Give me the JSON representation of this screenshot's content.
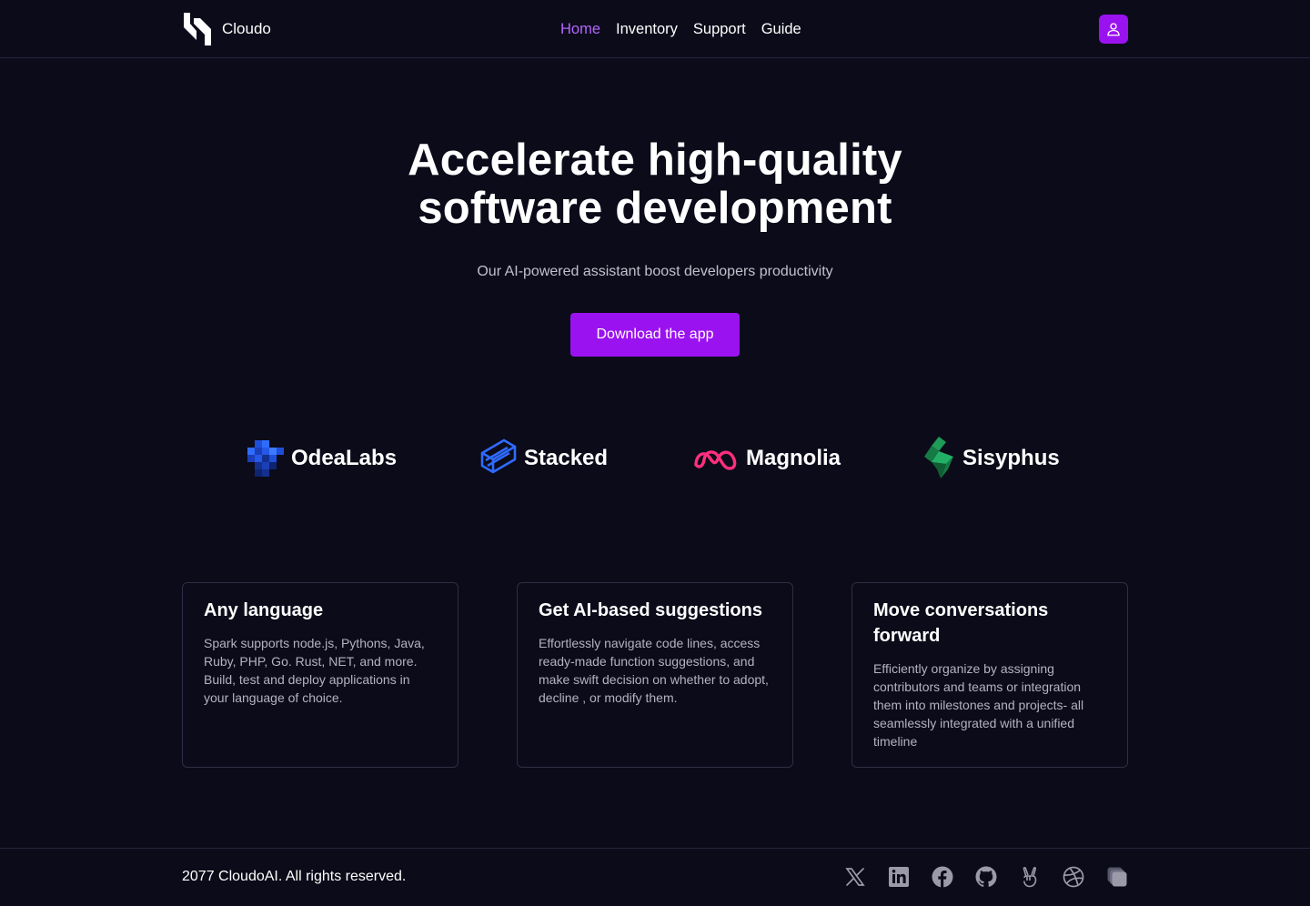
{
  "header": {
    "brand": "Cloudo",
    "nav": [
      {
        "label": "Home",
        "active": true
      },
      {
        "label": "Inventory",
        "active": false
      },
      {
        "label": "Support",
        "active": false
      },
      {
        "label": "Guide",
        "active": false
      }
    ],
    "user_icon": "user-icon"
  },
  "hero": {
    "title_line1": "Accelerate high-quality",
    "title_line2": "software development",
    "subtitle": "Our AI-powered assistant boost developers productivity",
    "cta_label": "Download the app"
  },
  "brands": [
    {
      "name": "OdeaLabs",
      "icon": "odealabs-logo"
    },
    {
      "name": "Stacked",
      "icon": "stacked-logo"
    },
    {
      "name": "Magnolia",
      "icon": "magnolia-logo"
    },
    {
      "name": "Sisyphus",
      "icon": "sisyphus-logo"
    }
  ],
  "features": [
    {
      "title": "Any language",
      "body": "Spark supports node.js, Pythons, Java, Ruby, PHP, Go. Rust, NET, and more. Build, test and deploy applications in your language of choice."
    },
    {
      "title": "Get AI-based suggestions",
      "body": "Effortlessly navigate code lines, access ready-made function suggestions, and make swift decision on whether to adopt, decline , or modify them."
    },
    {
      "title": "Move conversations forward",
      "body": "Efficiently organize by assigning contributors and teams  or integration them into milestones and projects- all seamlessly integrated with a unified timeline"
    }
  ],
  "footer": {
    "copyright": "2077 CloudoAI. All rights reserved.",
    "socials": [
      "x-icon",
      "linkedin-icon",
      "facebook-icon",
      "github-icon",
      "angellist-icon",
      "dribbble-icon",
      "buffer-icon"
    ]
  },
  "colors": {
    "background": "#0b0b1a",
    "accent": "#9b12f0",
    "nav_active": "#b466ff",
    "border": "#2e2e44"
  }
}
